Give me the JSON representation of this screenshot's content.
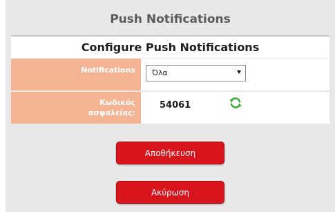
{
  "dialog": {
    "title": "Push Notifications"
  },
  "section": {
    "header": "Configure Push Notifications"
  },
  "form": {
    "notifications": {
      "label": "Notifications",
      "selected": "Όλα"
    },
    "security_code": {
      "label_line1": "Κωδικός",
      "label_line2": "ασφαλείας:",
      "value": "54061"
    }
  },
  "buttons": {
    "save": "Αποθήκευση",
    "cancel": "Ακύρωση"
  },
  "icons": {
    "refresh": "refresh-icon",
    "dropdown": "chevron-down-icon"
  },
  "colors": {
    "background": "#e8e8e8",
    "label_background": "#f4b494",
    "button": "#d8151c",
    "refresh_icon": "#3aa83a"
  }
}
